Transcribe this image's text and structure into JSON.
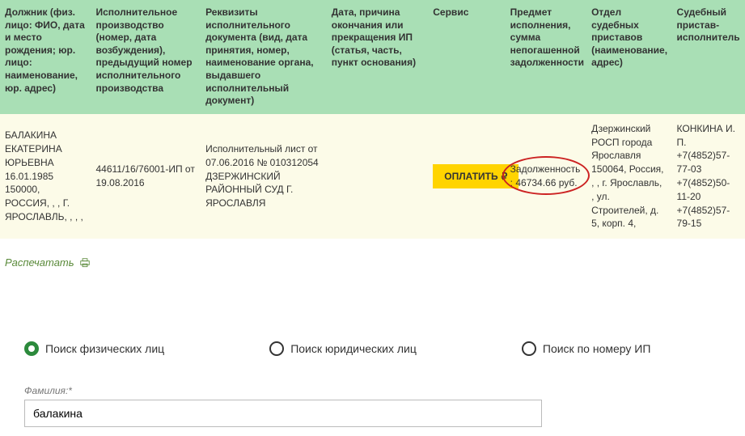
{
  "table": {
    "headers": [
      "Должник (физ. лицо: ФИО, дата и место рождения; юр. лицо: наименование, юр. адрес)",
      "Исполнительное производство (номер, дата возбуждения), предыдущий номер исполнительного производства",
      "Реквизиты исполнительного документа (вид, дата принятия, номер, наименование органа, выдавшего исполнительный документ)",
      "Дата, причина окончания или прекращения ИП (статья, часть, пункт основания)",
      "Сервис",
      "Предмет исполнения, сумма непогашенной задолженности",
      "Отдел судебных приставов (наименование, адрес)",
      "Судебный пристав-исполнитель"
    ],
    "row": {
      "debtor": "БАЛАКИНА ЕКАТЕРИНА ЮРЬЕВНА 16.01.1985 150000, РОССИЯ, , , Г. ЯРОСЛАВЛЬ, , , ,",
      "proceeding": "44611/16/76001-ИП от 19.08.2016",
      "document": "Исполнительный лист от 07.06.2016 № 010312054 ДЗЕРЖИНСКИЙ РАЙОННЫЙ СУД Г. ЯРОСЛАВЛЯ",
      "termination": "",
      "service_button": "ОПЛАТИТЬ",
      "debt": "Задолженность: 46734.66 руб.",
      "department": "Дзержинский РОСП города Ярославля 150064, Россия, , , г. Ярославль, , ул. Строителей, д. 5, корп. 4,",
      "officer": "КОНКИНА И. П.\n+7(4852)57-77-03\n+7(4852)50-11-20\n+7(4852)57-79-15"
    }
  },
  "print_label": "Распечатать",
  "search": {
    "radios": {
      "phys": "Поиск физических лиц",
      "legal": "Поиск юридических лиц",
      "ip": "Поиск по номеру ИП"
    },
    "lastname_label": "Фамилия:*",
    "lastname_value": "балакина"
  }
}
